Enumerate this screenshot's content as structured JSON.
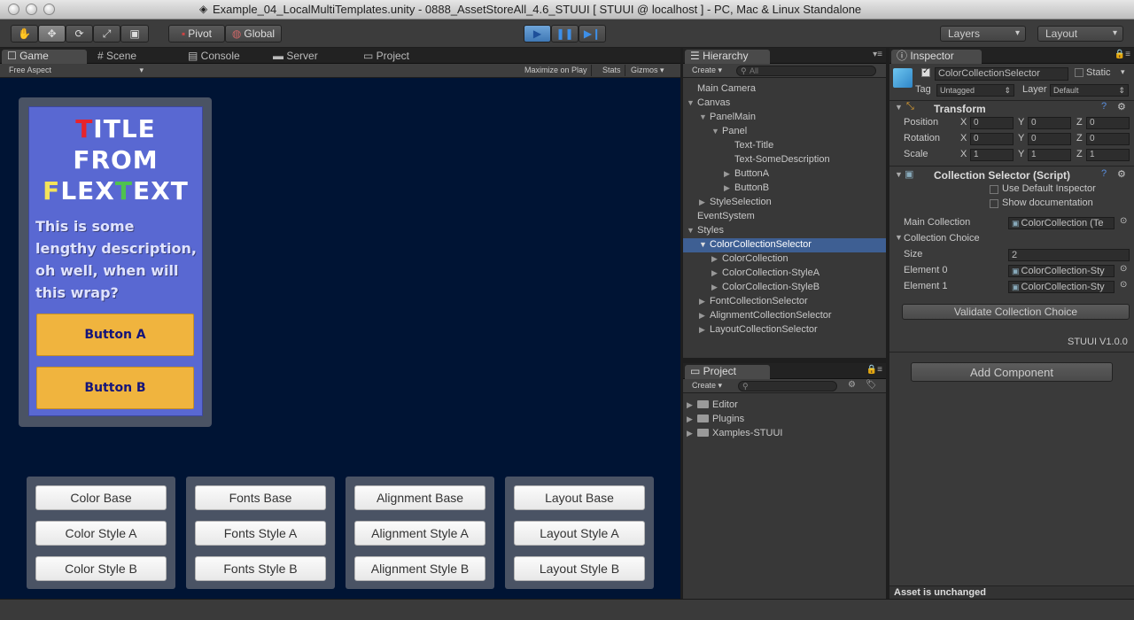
{
  "window": {
    "title": "Example_04_LocalMultiTemplates.unity - 0888_AssetStoreAll_4.6_STUUI [ STUUI @ localhost ] - PC, Mac & Linux Standalone"
  },
  "toolbar": {
    "pivot_label": "Pivot",
    "global_label": "Global",
    "layers_label": "Layers",
    "layout_label": "Layout"
  },
  "tabs": {
    "game": "Game",
    "scene": "Scene",
    "console": "Console",
    "server": "Server",
    "project_tab": "Project",
    "hierarchy": "Hierarchy",
    "project": "Project",
    "inspector": "Inspector"
  },
  "game_bar": {
    "aspect": "Free Aspect",
    "maximize": "Maximize on Play",
    "stats": "Stats",
    "gizmos": "Gizmos"
  },
  "game": {
    "title_lines": [
      "TITLE",
      "FROM",
      "FLEXTEXT"
    ],
    "description": "This is some lengthy description, oh well, when will this wrap?",
    "button_a": "Button A",
    "button_b": "Button B",
    "groups": [
      {
        "base": "Color Base",
        "a": "Color Style A",
        "b": "Color Style B"
      },
      {
        "base": "Fonts Base",
        "a": "Fonts Style A",
        "b": "Fonts Style B"
      },
      {
        "base": "Alignment Base",
        "a": "Alignment Style A",
        "b": "Alignment Style B"
      },
      {
        "base": "Layout Base",
        "a": "Layout Style A",
        "b": "Layout Style B"
      }
    ]
  },
  "hierarchy": {
    "create": "Create",
    "search_placeholder": "All",
    "items": [
      "Main Camera",
      "Canvas",
      "PanelMain",
      "Panel",
      "Text-Title",
      "Text-SomeDescription",
      "ButtonA",
      "ButtonB",
      "StyleSelection",
      "EventSystem",
      "Styles",
      "ColorCollectionSelector",
      "ColorCollection",
      "ColorCollection-StyleA",
      "ColorCollection-StyleB",
      "FontCollectionSelector",
      "AlignmentCollectionSelector",
      "LayoutCollectionSelector"
    ]
  },
  "project": {
    "create": "Create",
    "folders": [
      "Editor",
      "Plugins",
      "Xamples-STUUI"
    ]
  },
  "inspector": {
    "object_name": "ColorCollectionSelector",
    "static_label": "Static",
    "tag_label": "Tag",
    "tag_value": "Untagged",
    "layer_label": "Layer",
    "layer_value": "Default",
    "transform": {
      "title": "Transform",
      "position_label": "Position",
      "rotation_label": "Rotation",
      "scale_label": "Scale",
      "position": [
        "0",
        "0",
        "0"
      ],
      "rotation": [
        "0",
        "0",
        "0"
      ],
      "scale": [
        "1",
        "1",
        "1"
      ],
      "axes": [
        "X",
        "Y",
        "Z"
      ]
    },
    "script": {
      "title": "Collection Selector (Script)",
      "use_default": "Use Default Inspector",
      "show_doc": "Show documentation",
      "main_collection_label": "Main Collection",
      "main_collection_value": "ColorCollection (Te",
      "collection_choice": "Collection Choice",
      "size_label": "Size",
      "size_value": "2",
      "element0_label": "Element 0",
      "element0_value": "ColorCollection-Sty",
      "element1_label": "Element 1",
      "element1_value": "ColorCollection-Sty",
      "validate": "Validate Collection Choice",
      "version": "STUUI V1.0.0"
    },
    "add_component": "Add Component",
    "status": "Asset is unchanged"
  }
}
